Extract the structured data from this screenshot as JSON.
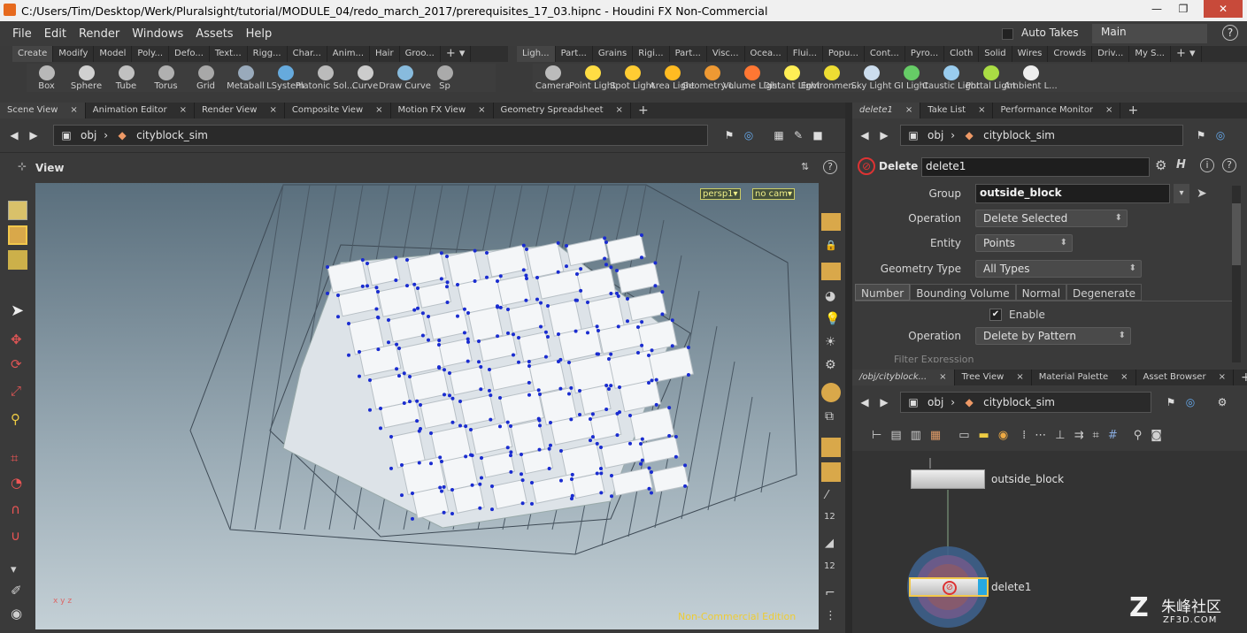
{
  "window": {
    "title": "C:/Users/Tim/Desktop/Werk/Pluralsight/tutorial/MODULE_04/redo_march_2017/prerequisites_17_03.hipnc - Houdini FX Non-Commercial",
    "controls": [
      "—",
      "❐",
      "✕"
    ]
  },
  "menu": [
    "File",
    "Edit",
    "Render",
    "Windows",
    "Assets",
    "Help"
  ],
  "header": {
    "auto_takes": "Auto Takes",
    "desktop": "Main",
    "help": "?"
  },
  "shelf_tabs_left": [
    "Create",
    "Modify",
    "Model",
    "Poly...",
    "Defo...",
    "Text...",
    "Rigg...",
    "Char...",
    "Anim...",
    "Hair",
    "Groo..."
  ],
  "shelf_tabs_right": [
    "Ligh...",
    "Part...",
    "Grains",
    "Rigi...",
    "Part...",
    "Visc...",
    "Ocea...",
    "Flui...",
    "Popu...",
    "Cont...",
    "Pyro...",
    "Cloth",
    "Solid",
    "Wires",
    "Crowds",
    "Driv...",
    "My S..."
  ],
  "tools_left": [
    {
      "label": "Box",
      "color": "#b8b8b8"
    },
    {
      "label": "Sphere",
      "color": "#d0d0d0"
    },
    {
      "label": "Tube",
      "color": "#c0c0c0"
    },
    {
      "label": "Torus",
      "color": "#b0b0b0"
    },
    {
      "label": "Grid",
      "color": "#a8a8a8"
    },
    {
      "label": "Metaball",
      "color": "#9ab"
    },
    {
      "label": "LSystem",
      "color": "#6ad"
    },
    {
      "label": "Platonic Sol...",
      "color": "#bbb"
    },
    {
      "label": "Curve",
      "color": "#ccc"
    },
    {
      "label": "Draw Curve",
      "color": "#8bd"
    },
    {
      "label": "Sp",
      "color": "#aaa"
    }
  ],
  "tools_right": [
    {
      "label": "Camera",
      "color": "#bbb"
    },
    {
      "label": "Point Light",
      "color": "#fd4"
    },
    {
      "label": "Spot Light",
      "color": "#fc3"
    },
    {
      "label": "Area Light",
      "color": "#fb2"
    },
    {
      "label": "Geometry L...",
      "color": "#e93"
    },
    {
      "label": "Volume Light",
      "color": "#f73"
    },
    {
      "label": "Distant Light",
      "color": "#fe5"
    },
    {
      "label": "Environmen...",
      "color": "#ed3"
    },
    {
      "label": "Sky Light",
      "color": "#cde"
    },
    {
      "label": "GI Light",
      "color": "#6c6"
    },
    {
      "label": "Caustic Light",
      "color": "#9ce"
    },
    {
      "label": "Portal Light",
      "color": "#ad4"
    },
    {
      "label": "Ambient L...",
      "color": "#eee"
    }
  ],
  "left_pane_tabs": [
    "Scene View",
    "Animation Editor",
    "Render View",
    "Composite View",
    "Motion FX View",
    "Geometry Spreadsheet"
  ],
  "left_path": {
    "root": "obj",
    "node": "cityblock_sim"
  },
  "viewport": {
    "title": "View",
    "persp": "persp1▾",
    "cam": "no cam▾",
    "watermark": "Non-Commercial Edition",
    "axis": "x y z"
  },
  "right_top_tabs": [
    "delete1",
    "Take List",
    "Performance Monitor"
  ],
  "right_path": {
    "root": "obj",
    "node": "cityblock_sim"
  },
  "params": {
    "node_type": "Delete",
    "node_name": "delete1",
    "group_label": "Group",
    "group_value": "outside_block",
    "operation_label": "Operation",
    "operation_value": "Delete Selected",
    "entity_label": "Entity",
    "entity_value": "Points",
    "geotype_label": "Geometry Type",
    "geotype_value": "All Types",
    "subtabs": [
      "Number",
      "Bounding Volume",
      "Normal",
      "Degenerate"
    ],
    "enable_label": "Enable",
    "operation2_label": "Operation",
    "operation2_value": "Delete by Pattern",
    "filter_label": "Filter Expression"
  },
  "network_tabs": [
    "/obj/cityblock...",
    "Tree View",
    "Material Palette",
    "Asset Browser"
  ],
  "network_path": {
    "root": "obj",
    "node": "cityblock_sim"
  },
  "nodes": {
    "n1": "outside_block",
    "n2": "delete1"
  },
  "brand": {
    "text": "朱峰社区",
    "sub": "ZF3D.COM"
  }
}
